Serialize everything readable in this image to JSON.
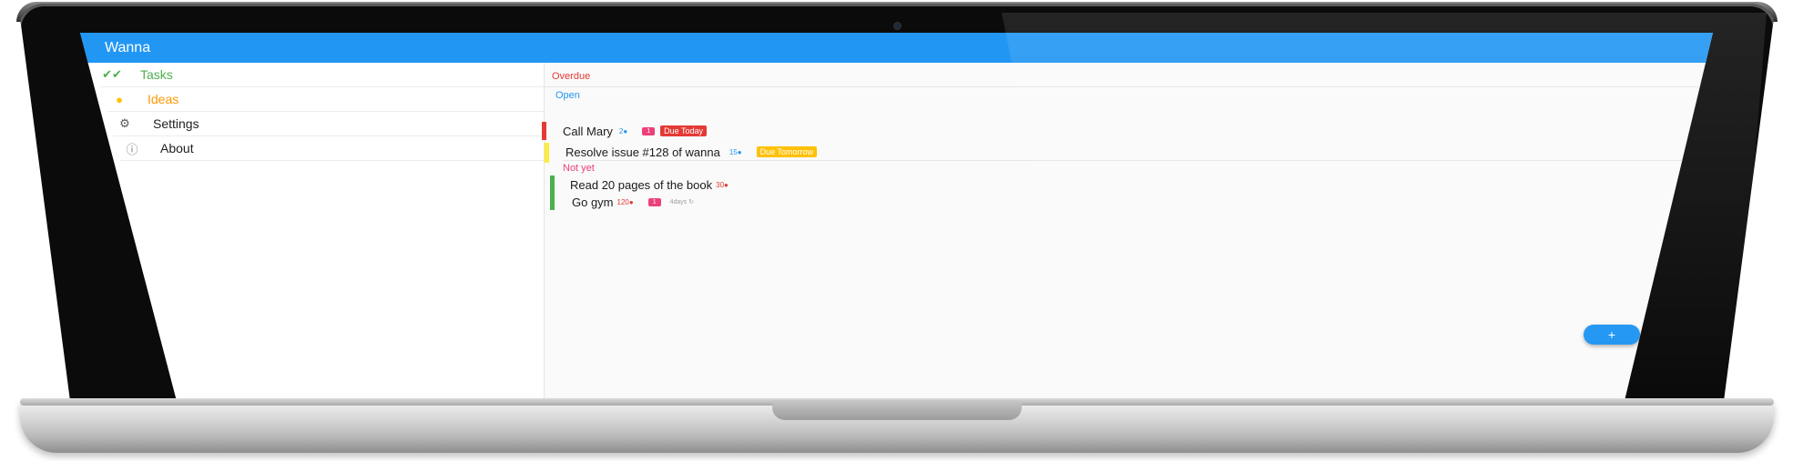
{
  "app": {
    "title": "Wanna"
  },
  "sidebar": {
    "items": [
      {
        "label": "Tasks",
        "icon": "double-check-icon",
        "color": "#4CAF50"
      },
      {
        "label": "Ideas",
        "icon": "lightbulb-icon",
        "color": "#FF9800"
      },
      {
        "label": "Settings",
        "icon": "gear-icon",
        "color": "#212121"
      },
      {
        "label": "About",
        "icon": "info-icon",
        "color": "#212121"
      }
    ]
  },
  "main": {
    "sections": {
      "overdue": "Overdue",
      "open": "Open",
      "not_yet": "Not yet"
    },
    "tasks": [
      {
        "title": "Call Mary",
        "points": "2",
        "count": "1",
        "due": "Due Today",
        "status_color": "#e53935"
      },
      {
        "title": "Resolve issue #128 of wanna",
        "points": "15",
        "due": "Due Tomorrow",
        "status_color": "#FFEB3B"
      },
      {
        "title": "Read 20 pages of the book",
        "points": "30",
        "status_color": "#4CAF50"
      },
      {
        "title": "Go gym",
        "points": "120",
        "count": "1",
        "repeat": "4days",
        "status_color": "#4CAF50"
      }
    ]
  },
  "fab": {
    "label": "+"
  },
  "colors": {
    "primary": "#2196F3",
    "overdue": "#e53935",
    "not_yet": "#ec407a",
    "due_today": "#e53935",
    "due_tomorrow": "#FFC107"
  }
}
